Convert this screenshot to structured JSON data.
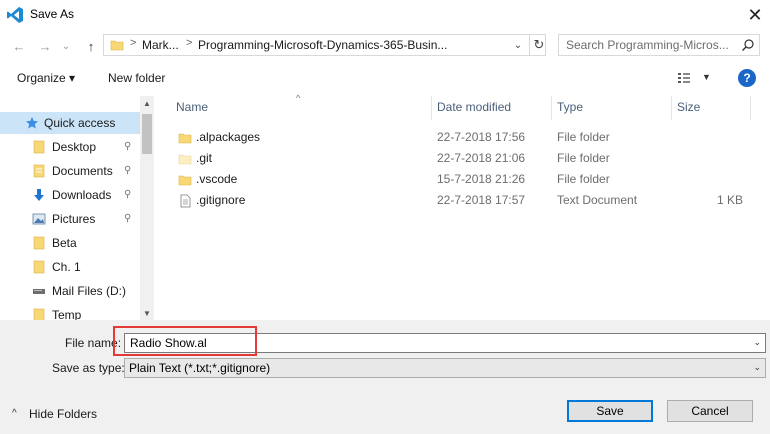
{
  "window": {
    "title": "Save As",
    "close_glyph": "✕"
  },
  "nav": {
    "back_glyph": "←",
    "forward_glyph": "→",
    "recent_glyph": "⌄",
    "up_glyph": "↑",
    "breadcrumbs": [
      "Mark...",
      "Programming-Microsoft-Dynamics-365-Busin..."
    ],
    "crumb_separator": ">",
    "refresh_glyph": "↻",
    "dropdown_glyph": "⌄"
  },
  "search": {
    "placeholder": "Search Programming-Micros..."
  },
  "toolbar": {
    "organize_label": "Organize ▾",
    "new_folder_label": "New folder",
    "view_dropdown_glyph": "▼",
    "help_label": "?"
  },
  "sidebar": {
    "items": [
      {
        "label": "Quick access",
        "icon": "star-icon",
        "pinned": false,
        "selected": true
      },
      {
        "label": "Desktop",
        "icon": "folder-icon",
        "pinned": true,
        "selected": false
      },
      {
        "label": "Documents",
        "icon": "documents-icon",
        "pinned": true,
        "selected": false
      },
      {
        "label": "Downloads",
        "icon": "download-icon",
        "pinned": true,
        "selected": false
      },
      {
        "label": "Pictures",
        "icon": "pictures-icon",
        "pinned": true,
        "selected": false
      },
      {
        "label": "Beta",
        "icon": "folder-icon",
        "pinned": false,
        "selected": false
      },
      {
        "label": "Ch. 1",
        "icon": "folder-icon",
        "pinned": false,
        "selected": false
      },
      {
        "label": "Mail Files (D:)",
        "icon": "drive-icon",
        "pinned": false,
        "selected": false
      },
      {
        "label": "Temp",
        "icon": "folder-icon",
        "pinned": false,
        "selected": false
      }
    ],
    "pin_glyph": "📌"
  },
  "files": {
    "columns": {
      "name": "Name",
      "date": "Date modified",
      "type": "Type",
      "size": "Size"
    },
    "sort_glyph": "^",
    "rows": [
      {
        "name": ".alpackages",
        "date": "22-7-2018 17:56",
        "type": "File folder",
        "size": "",
        "icon": "folder-icon"
      },
      {
        "name": ".git",
        "date": "22-7-2018 21:06",
        "type": "File folder",
        "size": "",
        "icon": "folder-hidden-icon"
      },
      {
        "name": ".vscode",
        "date": "15-7-2018 21:26",
        "type": "File folder",
        "size": "",
        "icon": "folder-icon"
      },
      {
        "name": ".gitignore",
        "date": "22-7-2018 17:57",
        "type": "Text Document",
        "size": "1 KB",
        "icon": "text-file-icon"
      }
    ]
  },
  "form": {
    "file_name_label": "File name:",
    "file_name_value": "Radio Show.al",
    "save_as_type_label": "Save as type:",
    "save_as_type_value": "Plain Text (*.txt;*.gitignore)",
    "dropdown_glyph": "⌄"
  },
  "footer": {
    "hide_folders_label": "Hide Folders",
    "hide_folders_glyph": "^",
    "save_label": "Save",
    "cancel_label": "Cancel"
  },
  "colors": {
    "accent": "#0078d7",
    "selection": "#cce4f7",
    "highlight_box": "#e53935",
    "folder": "#f8d775"
  }
}
